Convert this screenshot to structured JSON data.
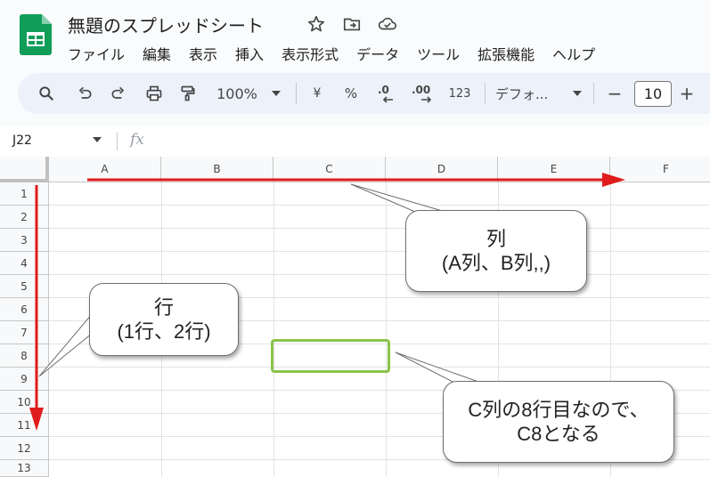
{
  "app": {
    "title": "無題のスプレッドシート",
    "icons": [
      "star-icon",
      "move-to-folder-icon",
      "cloud-saved-icon"
    ]
  },
  "menu": [
    "ファイル",
    "編集",
    "表示",
    "挿入",
    "表示形式",
    "データ",
    "ツール",
    "拡張機能",
    "ヘルプ"
  ],
  "toolbar": {
    "zoom": "100%",
    "currency": "¥",
    "percent": "%",
    "decrease_decimal": ".0",
    "increase_decimal": ".00",
    "number_format": "123",
    "font": "デフォ...",
    "font_size": "10",
    "minus": "−",
    "plus": "+"
  },
  "formula_bar": {
    "cell_ref": "J22",
    "fx": "fx"
  },
  "grid": {
    "columns": [
      "A",
      "B",
      "C",
      "D",
      "E",
      "F"
    ],
    "rows": [
      "1",
      "2",
      "3",
      "4",
      "5",
      "6",
      "7",
      "8",
      "9",
      "10",
      "11",
      "12",
      "13"
    ]
  },
  "annotations": {
    "column_callout": [
      "列",
      "(A列、B列,,)"
    ],
    "row_callout": [
      "行",
      "(1行、2行)"
    ],
    "cell_callout": [
      "C列の8行目なので、",
      "C8となる"
    ],
    "arrow_color": "#e01b1b",
    "highlight_color": "#8bc34a"
  },
  "colors": {
    "toolbar_bg": "#edf2fa",
    "sheets_green": "#0f9d58"
  }
}
